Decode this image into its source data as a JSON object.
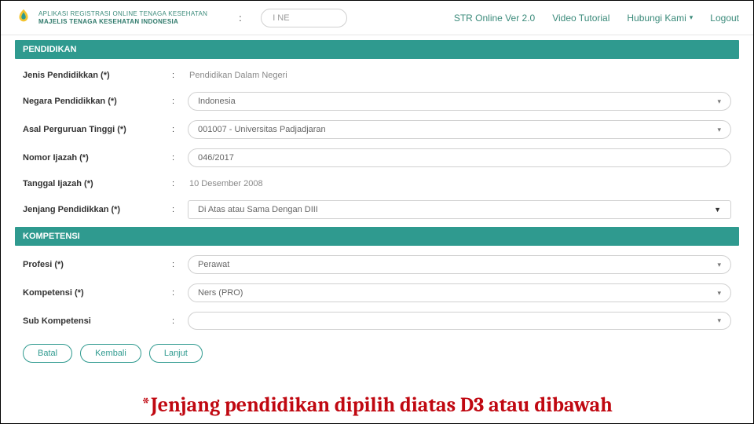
{
  "brand": {
    "line1": "APLIKASI REGISTRASI ONLINE TENAGA KESEHATAN",
    "line2": "MAJELIS TENAGA KESEHATAN INDONESIA"
  },
  "top_input": {
    "value": "I NE"
  },
  "nav": {
    "str": "STR Online Ver 2.0",
    "video": "Video Tutorial",
    "hubungi": "Hubungi Kami",
    "logout": "Logout"
  },
  "sections": {
    "pendidikan": "PENDIDIKAN",
    "kompetensi": "KOMPETENSI"
  },
  "pendidikan": {
    "jenis": {
      "label": "Jenis Pendidikkan (*)",
      "value": "Pendidikan Dalam Negeri"
    },
    "negara": {
      "label": "Negara Pendidikkan (*)",
      "value": "Indonesia"
    },
    "asal": {
      "label": "Asal Perguruan Tinggi (*)",
      "value": "001007 - Universitas Padjadjaran"
    },
    "nomor": {
      "label": "Nomor Ijazah (*)",
      "value": "046/2017"
    },
    "tanggal": {
      "label": "Tanggal Ijazah (*)",
      "value": "10 Desember 2008"
    },
    "jenjang": {
      "label": "Jenjang Pendidikkan (*)",
      "value": "Di Atas atau Sama Dengan DIII"
    }
  },
  "kompetensi": {
    "profesi": {
      "label": "Profesi (*)",
      "value": "Perawat"
    },
    "komp": {
      "label": "Kompetensi (*)",
      "value": "Ners  (PRO)"
    },
    "sub": {
      "label": "Sub Kompetensi",
      "value": ""
    }
  },
  "buttons": {
    "batal": "Batal",
    "kembali": "Kembali",
    "lanjut": "Lanjut"
  },
  "annotation": "*Jenjang pendidikan dipilih diatas D3 atau dibawah"
}
